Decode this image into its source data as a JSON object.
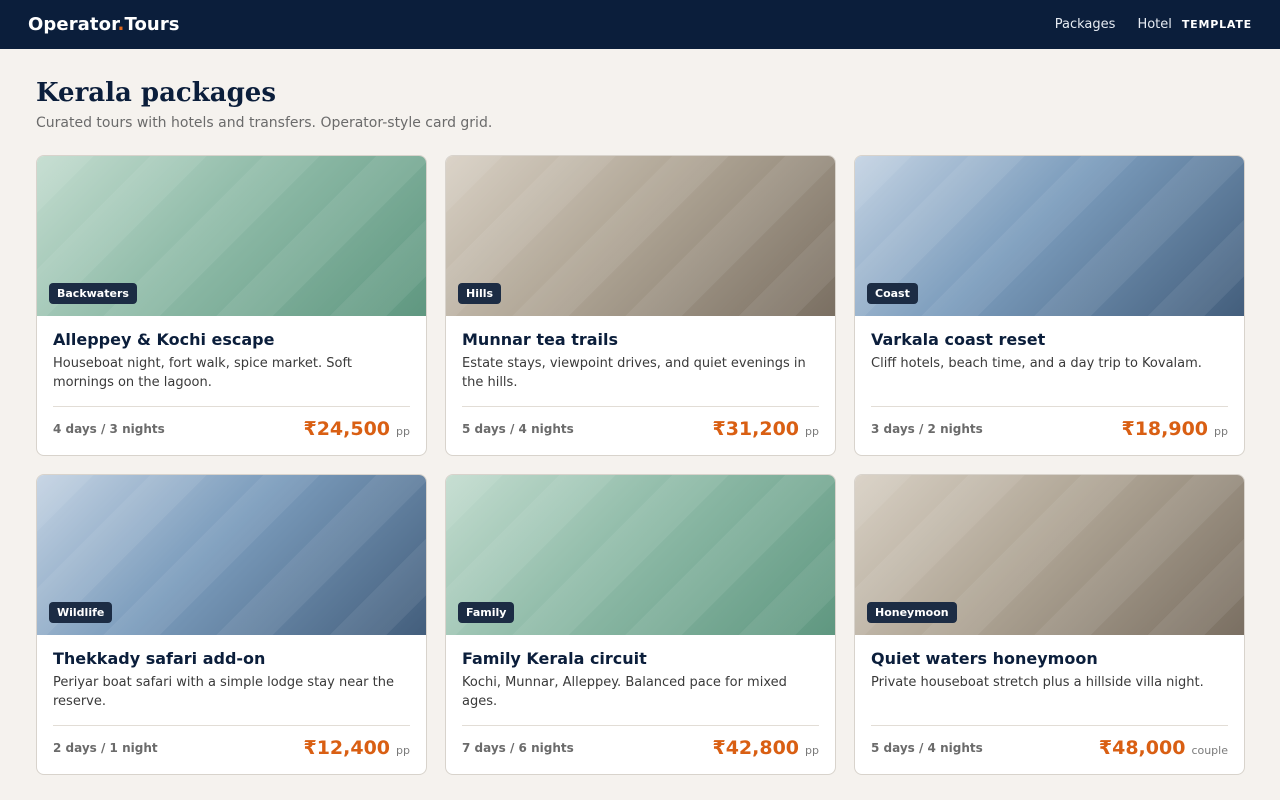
{
  "header": {
    "brand_part1": "Operator",
    "brand_dot": ".",
    "brand_part2": "Tours",
    "nav": [
      "Packages",
      "Hotel"
    ],
    "badge": "TEMPLATE"
  },
  "page": {
    "title": "Kerala packages",
    "subtitle": "Curated tours with hotels and transfers. Operator-style card grid."
  },
  "cards": [
    {
      "tag": "Backwaters",
      "title": "Alleppey & Kochi escape",
      "desc": "Houseboat night, fort walk, spice market. Soft mornings on the lagoon.",
      "duration": "4 days / 3 nights",
      "price": "₹24,500",
      "unit": "pp",
      "theme": "green"
    },
    {
      "tag": "Hills",
      "title": "Munnar tea trails",
      "desc": "Estate stays, viewpoint drives, and quiet evenings in the hills.",
      "duration": "5 days / 4 nights",
      "price": "₹31,200",
      "unit": "pp",
      "theme": "stone"
    },
    {
      "tag": "Coast",
      "title": "Varkala coast reset",
      "desc": "Cliff hotels, beach time, and a day trip to Kovalam.",
      "duration": "3 days / 2 nights",
      "price": "₹18,900",
      "unit": "pp",
      "theme": "blue"
    },
    {
      "tag": "Wildlife",
      "title": "Thekkady safari add-on",
      "desc": "Periyar boat safari with a simple lodge stay near the reserve.",
      "duration": "2 days / 1 night",
      "price": "₹12,400",
      "unit": "pp",
      "theme": "blue"
    },
    {
      "tag": "Family",
      "title": "Family Kerala circuit",
      "desc": "Kochi, Munnar, Alleppey. Balanced pace for mixed ages.",
      "duration": "7 days / 6 nights",
      "price": "₹42,800",
      "unit": "pp",
      "theme": "green"
    },
    {
      "tag": "Honeymoon",
      "title": "Quiet waters honeymoon",
      "desc": "Private houseboat stretch plus a hillside villa night.",
      "duration": "5 days / 4 nights",
      "price": "₹48,000",
      "unit": "couple",
      "theme": "stone"
    }
  ],
  "colors": {
    "header_bg": "#0b1e3b",
    "accent": "#e0661b",
    "price": "#d95f13",
    "page_bg": "#f5f2ee"
  }
}
